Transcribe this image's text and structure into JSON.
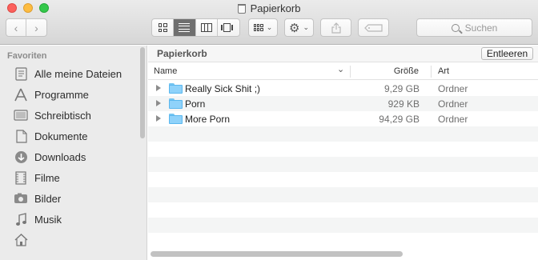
{
  "window": {
    "title": "Papierkorb"
  },
  "toolbar": {
    "back_icon": "chevron-left-icon",
    "forward_icon": "chevron-right-icon",
    "view_modes": [
      "icon-view",
      "list-view",
      "column-view",
      "cover-flow-view"
    ],
    "active_view": "list-view",
    "arrange_icon": "arrange-grid-icon",
    "action_icon": "gear-icon",
    "share_icon": "share-icon",
    "tag_icon": "tag-icon",
    "search_placeholder": "Suchen"
  },
  "sidebar": {
    "heading": "Favoriten",
    "items": [
      {
        "label": "Alle meine Dateien",
        "icon": "all-files-icon"
      },
      {
        "label": "Programme",
        "icon": "applications-icon"
      },
      {
        "label": "Schreibtisch",
        "icon": "desktop-icon"
      },
      {
        "label": "Dokumente",
        "icon": "documents-icon"
      },
      {
        "label": "Downloads",
        "icon": "downloads-icon"
      },
      {
        "label": "Filme",
        "icon": "movies-icon"
      },
      {
        "label": "Bilder",
        "icon": "pictures-icon"
      },
      {
        "label": "Musik",
        "icon": "music-icon"
      },
      {
        "label": "",
        "icon": "home-icon"
      }
    ]
  },
  "main": {
    "path_title": "Papierkorb",
    "empty_button": "Entleeren",
    "columns": {
      "name": "Name",
      "size": "Größe",
      "kind": "Art"
    },
    "rows": [
      {
        "name": "Really Sick Shit ;)",
        "size": "9,29 GB",
        "kind": "Ordner"
      },
      {
        "name": "Porn",
        "size": "929 KB",
        "kind": "Ordner"
      },
      {
        "name": "More Porn",
        "size": "94,29 GB",
        "kind": "Ordner"
      }
    ]
  },
  "colors": {
    "accent_folder": "#8fd2fa",
    "sidebar_bg": "#ebebeb",
    "close": "#fc605c",
    "minimize": "#fdbc40",
    "zoom": "#34c84a"
  }
}
